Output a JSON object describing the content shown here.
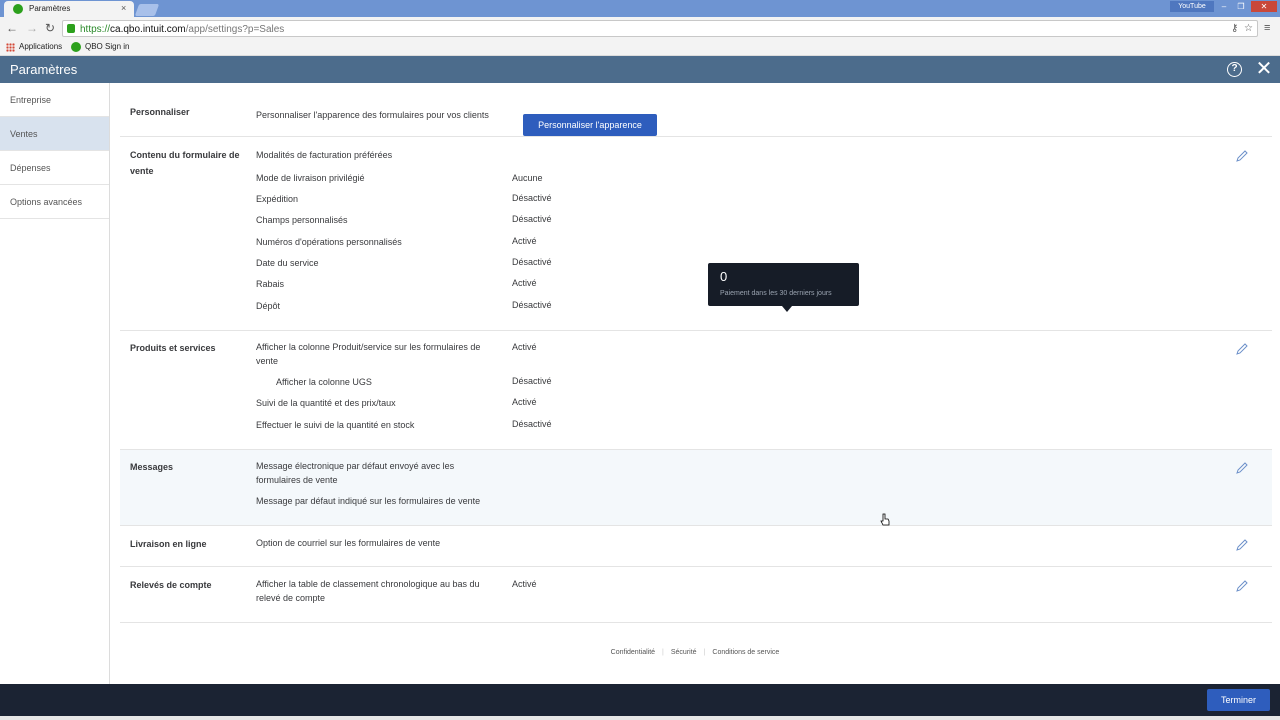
{
  "browser": {
    "tab_title": "Paramètres",
    "tab_close": "×",
    "youtube_label": "YouTube",
    "url_scheme": "https://",
    "url_host": "ca.qbo.intuit.com",
    "url_path": "/app/settings?p=Sales",
    "bookmarks": [
      "Applications",
      "QBO Sign in"
    ]
  },
  "header": {
    "title": "Paramètres",
    "help_glyph": "?",
    "close_glyph": "✕"
  },
  "sidebar": {
    "items": [
      {
        "label": "Entreprise"
      },
      {
        "label": "Ventes"
      },
      {
        "label": "Dépenses"
      },
      {
        "label": "Options avancées"
      }
    ]
  },
  "sections": {
    "personnaliser": {
      "title": "Personnaliser",
      "description": "Personnaliser l'apparence des formulaires pour vos clients",
      "button": "Personnaliser l'apparence"
    },
    "contenu": {
      "title": "Contenu du formulaire de vente",
      "rows": [
        {
          "label": "Modalités de facturation préférées",
          "value": ""
        },
        {
          "label": "Mode de livraison privilégié",
          "value": "Aucune"
        },
        {
          "label": "Expédition",
          "value": "Désactivé"
        },
        {
          "label": "Champs personnalisés",
          "value": "Désactivé"
        },
        {
          "label": "Numéros d'opérations personnalisés",
          "value": "Activé"
        },
        {
          "label": "Date du service",
          "value": "Désactivé"
        },
        {
          "label": "Rabais",
          "value": "Activé"
        },
        {
          "label": "Dépôt",
          "value": "Désactivé"
        }
      ]
    },
    "produits": {
      "title": "Produits et services",
      "rows": [
        {
          "label": "Afficher la colonne Produit/service sur les formulaires de vente",
          "value": "Activé"
        },
        {
          "label": "Afficher la colonne UGS",
          "value": "Désactivé"
        },
        {
          "label": "Suivi de la quantité et des prix/taux",
          "value": "Activé"
        },
        {
          "label": "Effectuer le suivi de la quantité en stock",
          "value": "Désactivé"
        }
      ]
    },
    "messages": {
      "title": "Messages",
      "rows": [
        {
          "label": "Message électronique par défaut envoyé avec les formulaires de vente"
        },
        {
          "label": "Message par défaut indiqué sur les formulaires de vente"
        }
      ]
    },
    "livraison": {
      "title": "Livraison en ligne",
      "rows": [
        {
          "label": "Option de courriel sur les formulaires de vente"
        }
      ]
    },
    "releves": {
      "title": "Relevés de compte",
      "rows": [
        {
          "label": "Afficher la table de classement chronologique au bas du relevé de compte",
          "value": "Activé"
        }
      ]
    }
  },
  "tooltip": {
    "count": "0",
    "caption": "Paiement dans les 30 derniers jours"
  },
  "footer": {
    "links": [
      "Confidentialité",
      "Sécurité",
      "Conditions de service"
    ],
    "done_button": "Terminer"
  },
  "colors": {
    "header": "#4c6c8c",
    "primary_button": "#2e5dbd",
    "bottom_bar": "#1b2333",
    "active_sidebar": "#d8e2ee"
  }
}
